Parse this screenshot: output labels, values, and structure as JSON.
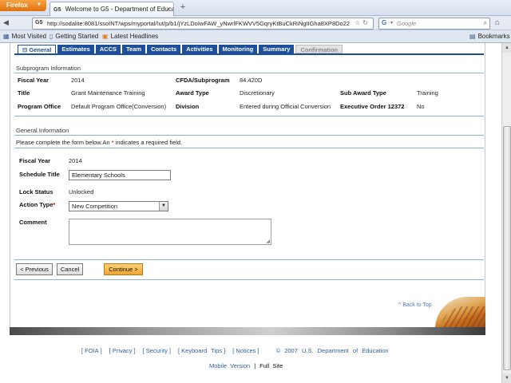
{
  "browser": {
    "menu_button": "Firefox",
    "tab_favicon": "G5",
    "tab_title": "Welcome to G5 - Department of Educati...",
    "new_tab": "+",
    "url": "http://sodalite:8081/ssoINT/wps/myportal/!ut/p/b1/jYzLDoIwFAW_yNwrlFKWVV5GqryKtBuCkRiNgIIGha8XP8Do22",
    "search_placeholder": "Google",
    "bookmarks": [
      "Most Visited",
      "Getting Started",
      "Latest Headlines"
    ],
    "bookmarks_right": "Bookmarks"
  },
  "tabs": [
    {
      "label": "General",
      "state": "active"
    },
    {
      "label": "Estimates",
      "state": "normal"
    },
    {
      "label": "ACCS",
      "state": "normal"
    },
    {
      "label": "Team",
      "state": "normal"
    },
    {
      "label": "Contacts",
      "state": "normal"
    },
    {
      "label": "Activities",
      "state": "normal"
    },
    {
      "label": "Monitoring",
      "state": "normal"
    },
    {
      "label": "Summary",
      "state": "normal"
    },
    {
      "label": "Confirmation",
      "state": "disabled"
    }
  ],
  "subprogram": {
    "heading": "Subprogram Information",
    "fiscal_year_label": "Fiscal Year",
    "fiscal_year": "2014",
    "cfda_label": "CFDA/Subprogram",
    "cfda": "84.420D",
    "title_label": "Title",
    "title": "Grant Maintenance Training",
    "award_type_label": "Award Type",
    "award_type": "Discretionary",
    "sub_award_type_label": "Sub Award Type",
    "sub_award_type": "Training",
    "program_office_label": "Program Office",
    "program_office": "Default Program Office(Conversion)",
    "division_label": "Division",
    "division": "Entered during Official Conversion",
    "exec_order_label": "Executive Order 12372",
    "exec_order": "No"
  },
  "general": {
    "heading": "General Information",
    "instructions_pre": "Please complete the form below.An ",
    "instructions_star": "*",
    "instructions_post": " indicates a required field.",
    "fiscal_year_label": "Fiscal Year",
    "fiscal_year": "2014",
    "schedule_title_label": "Schedule Title",
    "schedule_title": "Elementary Schools",
    "lock_status_label": "Lock Status",
    "lock_status": "Unlocked",
    "action_type_label": "Action Type",
    "action_type_star": "*",
    "action_type": "New Competition",
    "comment_label": "Comment",
    "comment": ""
  },
  "buttons": {
    "previous": "< Previous",
    "cancel": "Cancel",
    "continue": "Continue >"
  },
  "back_to_top": "^ Back to Top",
  "footer": {
    "links": [
      "FOIA",
      "Privacy",
      "Security",
      "Keyboard Tips",
      "Notices"
    ],
    "copyright": "© 2007 U.S. Department of Education",
    "mobile": "Mobile Version",
    "full": "Full Site",
    "pipe": "|"
  }
}
